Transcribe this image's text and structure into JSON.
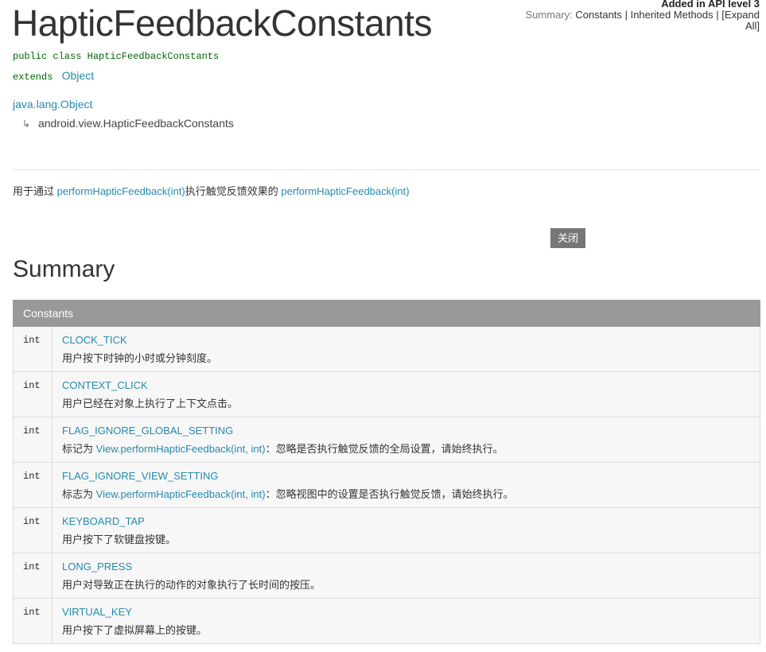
{
  "header": {
    "api_level": "Added in API level 3",
    "summary_prefix": "Summary:",
    "nav_constants": "Constants",
    "sep": "|",
    "nav_inherited": "Inherited Methods",
    "nav_expand": "[Expand All]"
  },
  "class": {
    "title": "HapticFeedbackConstants",
    "declaration": "public class HapticFeedbackConstants",
    "extends_keyword": "extends",
    "superclass": "Object"
  },
  "hierarchy": {
    "root": "java.lang.Object",
    "arrow": "↳",
    "child": "android.view.HapticFeedbackConstants"
  },
  "description": {
    "prefix": "用于通过",
    "link1": "performHapticFeedback(int)",
    "middle": "执行触觉反馈效果的",
    "link2": "performHapticFeedback(int)"
  },
  "close_button": "关闭",
  "summary": {
    "title": "Summary",
    "table_header": "Constants",
    "rows": [
      {
        "type": "int",
        "name": "CLOCK_TICK",
        "desc": "用户按下时钟的小时或分钟刻度。"
      },
      {
        "type": "int",
        "name": "CONTEXT_CLICK",
        "desc": "用户已经在对象上执行了上下文点击。"
      },
      {
        "type": "int",
        "name": "FLAG_IGNORE_GLOBAL_SETTING",
        "desc_prefix": "标记为",
        "desc_link": "View.performHapticFeedback(int, int)",
        "desc_suffix": "：忽略是否执行触觉反馈的全局设置，请始终执行。"
      },
      {
        "type": "int",
        "name": "FLAG_IGNORE_VIEW_SETTING",
        "desc_prefix": "标志为",
        "desc_link": "View.performHapticFeedback(int, int)",
        "desc_suffix": "：忽略视图中的设置是否执行触觉反馈，请始终执行。"
      },
      {
        "type": "int",
        "name": "KEYBOARD_TAP",
        "desc": "用户按下了软键盘按键。"
      },
      {
        "type": "int",
        "name": "LONG_PRESS",
        "desc": "用户对导致正在执行的动作的对象执行了长时间的按压。"
      },
      {
        "type": "int",
        "name": "VIRTUAL_KEY",
        "desc": "用户按下了虚拟屏幕上的按键。"
      }
    ]
  }
}
